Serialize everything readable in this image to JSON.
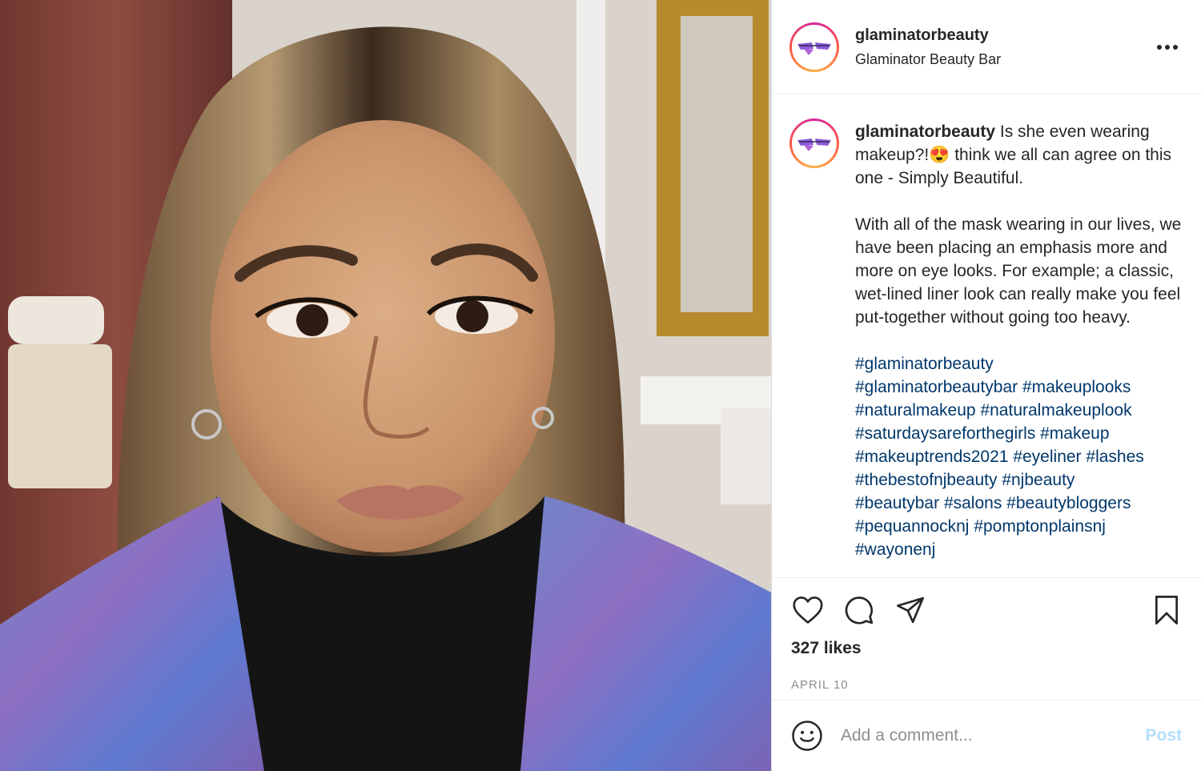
{
  "post": {
    "username": "glaminatorbeauty",
    "location": "Glaminator Beauty Bar",
    "caption_user": "glaminatorbeauty",
    "caption_text": " Is she even wearing makeup?!😍 think we all can agree on this one - Simply Beautiful.\n\nWith all of the mask wearing in our lives, we have been placing an emphasis more and more on eye looks. For example; a classic, wet-lined liner look can really make you feel put-together without going too heavy.\n\n",
    "hashtags": [
      "#glaminatorbeauty",
      "#glaminatorbeautybar",
      "#makeuplooks",
      "#naturalmakeup",
      "#naturalmakeuplook",
      "#saturdaysareforthegirls",
      "#makeup",
      "#makeuptrends2021",
      "#eyeliner",
      "#lashes",
      "#thebestofnjbeauty",
      "#njbeauty",
      "#beautybar",
      "#salons",
      "#beautybloggers",
      "#pequannocknj",
      "#pomptonplainsnj",
      "#wayonenj"
    ],
    "likes": "327 likes",
    "date": "APRIL 10"
  },
  "comment": {
    "placeholder": "Add a comment...",
    "post_label": "Post"
  },
  "colors": {
    "hashtag": "#00376b",
    "post_button": "#b2dffc",
    "muted": "#8e8e8e"
  },
  "icons": {
    "header_more": "more-horizontal-icon",
    "like": "heart-icon",
    "comment": "comment-icon",
    "share": "paper-plane-icon",
    "save": "bookmark-icon",
    "emoji": "smiley-icon"
  }
}
